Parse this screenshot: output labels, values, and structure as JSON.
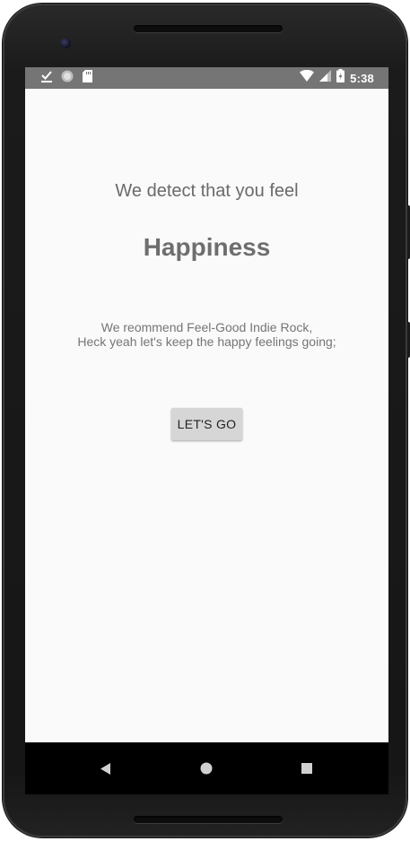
{
  "status_bar": {
    "time": "5:38",
    "left_icons": [
      "download-done-icon",
      "sync-circle-icon",
      "sd-card-icon"
    ],
    "right_icons": [
      "wifi-icon",
      "cell-signal-icon",
      "battery-charging-icon"
    ],
    "background_color": "#757575"
  },
  "main": {
    "headline": "We detect that you feel",
    "emotion": "Happiness",
    "recommendation_line1": "We reommend Feel-Good Indie Rock,",
    "recommendation_line2": "Heck yeah let's keep the happy feelings going;",
    "go_button_label": "LET'S GO",
    "background_color": "#fafafa"
  },
  "nav_bar": {
    "items": [
      "back-icon",
      "home-icon",
      "recents-icon"
    ]
  }
}
